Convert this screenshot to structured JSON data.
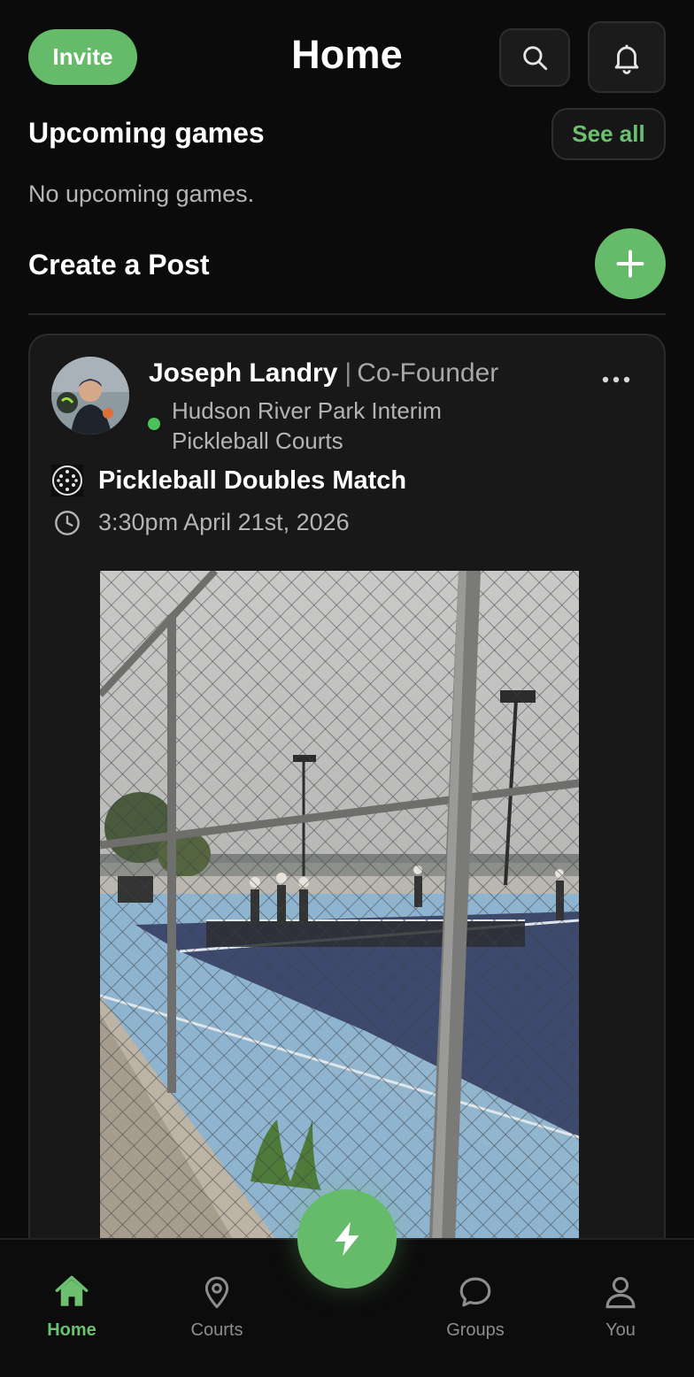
{
  "header": {
    "title": "Home",
    "invite_label": "Invite",
    "search_icon": "search-icon",
    "bell_icon": "bell-icon"
  },
  "upcoming": {
    "title": "Upcoming games",
    "see_all_label": "See all",
    "empty_text": "No upcoming games."
  },
  "create_post": {
    "title": "Create a Post",
    "add_icon": "plus-icon"
  },
  "post": {
    "author_name": "Joseph Landry",
    "separator": "|",
    "author_role": "Co-Founder",
    "online": true,
    "location": "Hudson River Park Interim Pickleball Courts",
    "game_title": "Pickleball Doubles Match",
    "game_time": "3:30pm April 21st, 2026",
    "more_icon": "more-horizontal-icon"
  },
  "bottom_nav": {
    "items": [
      {
        "label": "Home",
        "icon": "home-icon",
        "active": true
      },
      {
        "label": "Courts",
        "icon": "map-pin-icon",
        "active": false
      },
      {
        "label": "Groups",
        "icon": "chat-bubble-icon",
        "active": false
      },
      {
        "label": "You",
        "icon": "user-icon",
        "active": false
      }
    ],
    "center_action_icon": "lightning-bolt-icon"
  },
  "colors": {
    "background": "#0b0b0b",
    "card": "#181818",
    "accent_green": "#66bb6a",
    "muted_text": "#b4b4b4"
  }
}
